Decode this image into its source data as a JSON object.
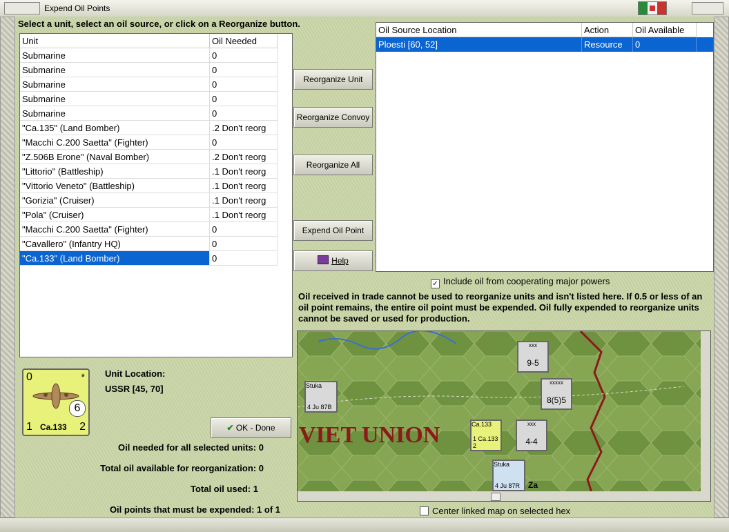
{
  "window": {
    "title": "Expend Oil Points"
  },
  "instruction": "Select a unit, select an oil source, or click on a Reorganize button.",
  "unit_table": {
    "headers": [
      "Unit",
      "Oil Needed"
    ],
    "rows": [
      [
        "Submarine",
        "0"
      ],
      [
        "Submarine",
        "0"
      ],
      [
        "Submarine",
        "0"
      ],
      [
        "Submarine",
        "0"
      ],
      [
        "Submarine",
        "0"
      ],
      [
        "\"Ca.135\" (Land Bomber)",
        ".2 Don't reorg"
      ],
      [
        "\"Macchi C.200 Saetta\" (Fighter)",
        "0"
      ],
      [
        "\"Z.506B Erone\" (Naval Bomber)",
        ".2 Don't reorg"
      ],
      [
        "\"Littorio\" (Battleship)",
        ".1 Don't reorg"
      ],
      [
        "\"Vittorio Veneto\" (Battleship)",
        ".1 Don't reorg"
      ],
      [
        "\"Gorizia\" (Cruiser)",
        ".1 Don't reorg"
      ],
      [
        "\"Pola\" (Cruiser)",
        ".1 Don't reorg"
      ],
      [
        "\"Macchi C.200 Saetta\" (Fighter)",
        "0"
      ],
      [
        "\"Cavallero\" (Infantry HQ)",
        "0"
      ],
      [
        "\"Ca.133\" (Land Bomber)",
        "0"
      ]
    ],
    "selected_index": 14
  },
  "buttons": {
    "reorganize_unit": "Reorganize Unit",
    "reorganize_convoy": "Reorganize Convoy",
    "reorganize_all": "Reorganize All",
    "expend_oil_point": "Expend Oil Point",
    "help": "Help",
    "ok_done": "OK - Done"
  },
  "oil_table": {
    "headers": [
      "Oil Source Location",
      "Action",
      "Oil Available"
    ],
    "rows": [
      [
        "Ploesti [60, 52]",
        "Resource",
        "0"
      ]
    ]
  },
  "include_oil_label": "Include oil from cooperating major powers",
  "include_oil_checked": true,
  "note": "Oil received in trade cannot be used to reorganize units and isn't listed here. If 0.5 or less of an oil point remains, the entire oil point must be expended. Oil fully expended to reorganize units cannot be saved or used for production.",
  "unit_counter": {
    "name": "Ca.133",
    "top_left": "0",
    "star": "*",
    "circle": "6",
    "bottom_left": "1",
    "bottom_right": "2"
  },
  "unit_location": {
    "label": "Unit Location:",
    "value": "USSR [45, 70]"
  },
  "stats": {
    "oil_needed_label": "Oil needed for all selected units:",
    "oil_needed": "0",
    "total_available_label": "Total oil available for reorganization:",
    "total_available": "0",
    "total_used_label": "Total oil used:",
    "total_used": "1",
    "must_expend_label": "Oil points that must be expended:",
    "must_expend": "1 of 1"
  },
  "map": {
    "region_label": "VIET UNION",
    "counters": [
      {
        "code": "xxx",
        "value": "9-5",
        "badge": "3"
      },
      {
        "code": "xxxxx",
        "value": "8(5)5",
        "badge": "3"
      },
      {
        "code": "xxx",
        "value": "4-4",
        "badge": ""
      },
      {
        "code": "Stuka",
        "value": "4 Ju 87B",
        "badge": "3"
      },
      {
        "code": "Stuka",
        "value": "4 Ju 87R",
        "badge": "6"
      },
      {
        "code": "Ca.133",
        "value": "1 Ca.133 2",
        "badge": "6"
      }
    ],
    "partial_label": "Za"
  },
  "center_map_label": "Center linked map on selected hex",
  "center_map_checked": false,
  "colors": {
    "selection": "#0a64d2",
    "panel": "#c9d3a8",
    "map_border": "#8b1a1a"
  }
}
